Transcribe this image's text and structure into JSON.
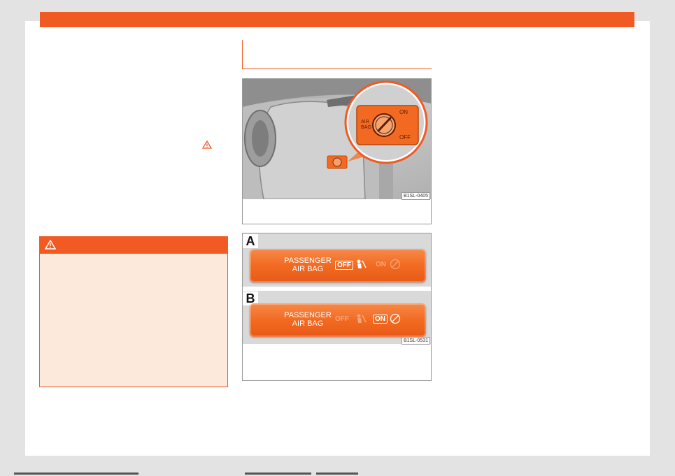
{
  "header": {
    "accent": "#f15a22"
  },
  "warning": {
    "icon": "warning-triangle-icon"
  },
  "figure1": {
    "code": "B1SL-0405",
    "switch_label_line1": "AIR",
    "switch_label_line2": "BAG",
    "on_label": "ON",
    "off_label": "OFF"
  },
  "figure2": {
    "code": "B1SL-0531",
    "panel_a": {
      "letter": "A",
      "label_line1": "PASSENGER",
      "label_line2": "AIR BAG",
      "off_text": "OFF",
      "on_text": "ON"
    },
    "panel_b": {
      "letter": "B",
      "label_line1": "PASSENGER",
      "label_line2": "AIR BAG",
      "off_text": "OFF",
      "on_text": "ON"
    }
  }
}
